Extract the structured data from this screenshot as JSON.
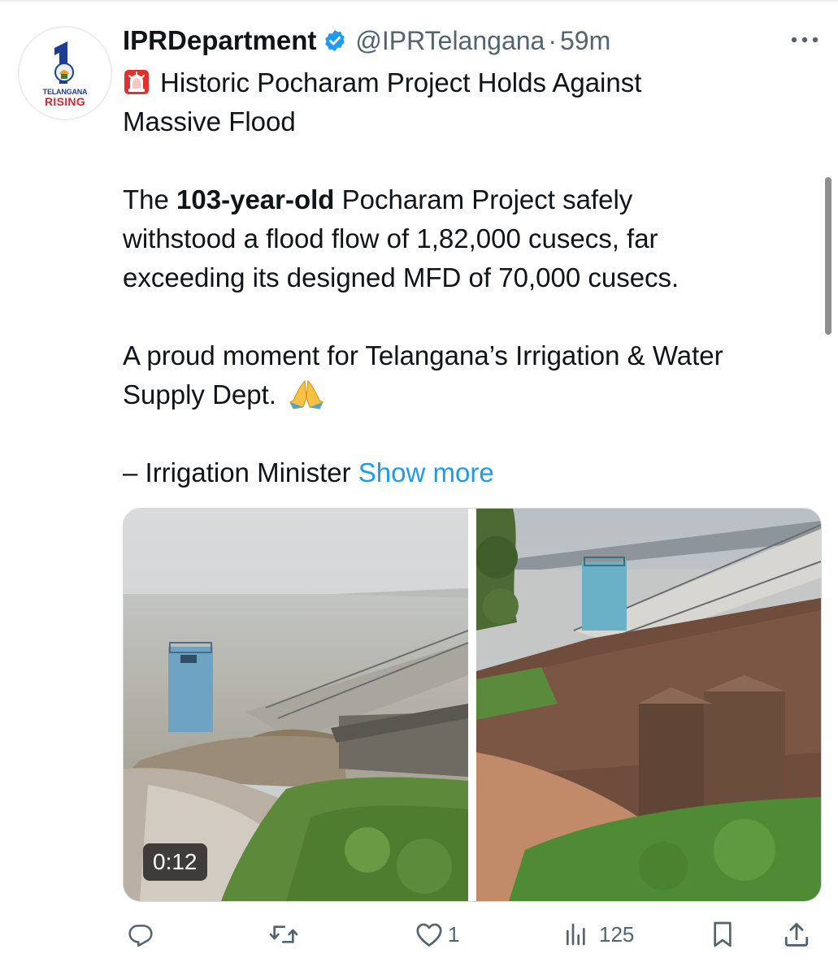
{
  "tweet": {
    "author_name": "IPRDepartment",
    "handle": "@IPRTelangana",
    "separator": "·",
    "time": "59m",
    "title_line_1": "Historic Pocharam Project Holds Against",
    "title_line_2": "Massive Flood",
    "p1_a": "The ",
    "p1_bold": "103-year-old",
    "p1_b": " Pocharam Project safely",
    "p1_line2": "withstood a flood flow of 1,82,000 cusecs, far",
    "p1_line3": "exceeding its designed MFD of 70,000 cusecs.",
    "p2_line1": "A proud moment for Telangana’s Irrigation & Water",
    "p2_line2": "Supply Dept.",
    "p3": "– Irrigation Minister ",
    "show_more": "Show more"
  },
  "avatar": {
    "line1": "TELANGANA",
    "line2": "RISING"
  },
  "media": {
    "video_duration": "0:12"
  },
  "actions": {
    "reply_count": "",
    "retweet_count": "",
    "like_count": "1",
    "views_count": "125"
  },
  "icons": {
    "verified": "verified-badge-icon",
    "more": "more-options-icon",
    "siren": "police-light-emoji",
    "pray": "folded-hands-emoji",
    "reply": "reply-icon",
    "retweet": "retweet-icon",
    "like": "heart-icon",
    "views": "views-icon",
    "bookmark": "bookmark-icon",
    "share": "share-icon"
  },
  "colors": {
    "link": "#1d9bf0",
    "secondary_text": "#536471",
    "verified": "#1d9bf0"
  }
}
